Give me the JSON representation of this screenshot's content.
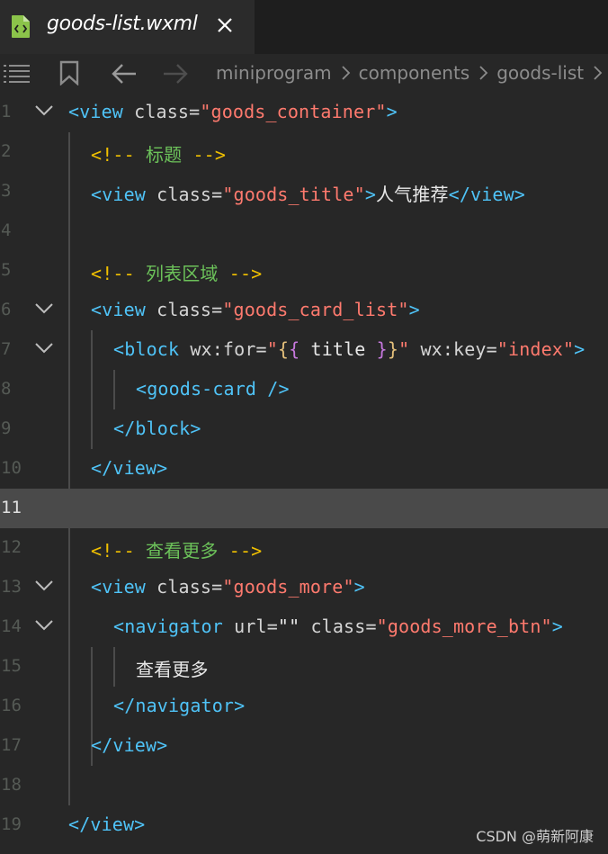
{
  "tab": {
    "title": "goods-list.wxml",
    "file_icon": "wxml-file-icon",
    "close_icon": "close-icon"
  },
  "toolbar": {
    "icons": [
      "outline-list-icon",
      "bookmark-icon",
      "back-arrow-icon",
      "forward-arrow-icon"
    ],
    "breadcrumb": [
      "miniprogram",
      "components",
      "goods-list"
    ]
  },
  "editor": {
    "current_line": 11,
    "lines": [
      {
        "num": "1"
      },
      {
        "num": "2"
      },
      {
        "num": "3"
      },
      {
        "num": "4"
      },
      {
        "num": "5"
      },
      {
        "num": "6"
      },
      {
        "num": "7"
      },
      {
        "num": "8"
      },
      {
        "num": "9"
      },
      {
        "num": "10"
      },
      {
        "num": "11"
      },
      {
        "num": "12"
      },
      {
        "num": "13"
      },
      {
        "num": "14"
      },
      {
        "num": "15"
      },
      {
        "num": "16"
      },
      {
        "num": "17"
      },
      {
        "num": "18"
      },
      {
        "num": "19"
      }
    ],
    "code": {
      "l1": {
        "open": "<",
        "tag": "view",
        "attr": " class=",
        "q1": "\"",
        "val": "goods_container",
        "q2": "\"",
        "close": ">"
      },
      "l2": {
        "c_open": "<!--",
        "c_text": " 标题 ",
        "c_close": "-->"
      },
      "l3": {
        "open": "<",
        "tag": "view",
        "attr": " class=",
        "q1": "\"",
        "val": "goods_title",
        "q2": "\"",
        "close": ">",
        "text": "人气推荐",
        "end": "</view>"
      },
      "l5": {
        "c_open": "<!--",
        "c_text": " 列表区域 ",
        "c_close": "-->"
      },
      "l6": {
        "open": "<",
        "tag": "view",
        "attr": " class=",
        "q1": "\"",
        "val": "goods_card_list",
        "q2": "\"",
        "close": ">"
      },
      "l7": {
        "open": "<",
        "tag": "block",
        "attr": " wx:for=",
        "q1": "\"",
        "b1": "{",
        "b2": "{",
        "expr": " title ",
        "b3": "}",
        "b4": "}",
        "q2": "\"",
        "attr2": " wx:key=",
        "q3": "\"",
        "val2": "index",
        "q4": "\"",
        "close": ">"
      },
      "l8": {
        "text": "<goods-card />"
      },
      "l9": {
        "text": "</block>"
      },
      "l10": {
        "text": "</view>"
      },
      "l12": {
        "c_open": "<!--",
        "c_text": " 查看更多 ",
        "c_close": "-->"
      },
      "l13": {
        "open": "<",
        "tag": "view",
        "attr": " class=",
        "q1": "\"",
        "val": "goods_more",
        "q2": "\"",
        "close": ">"
      },
      "l14": {
        "open": "<",
        "tag": "navigator",
        "attr": " url=",
        "qq": "\"\"",
        "attr2": " class=",
        "q1": "\"",
        "val": "goods_more_btn",
        "q2": "\"",
        "close": ">"
      },
      "l15": {
        "text": "查看更多"
      },
      "l16": {
        "text": "</navigator>"
      },
      "l17": {
        "text": "</view>"
      },
      "l19": {
        "text": "</view>"
      }
    }
  },
  "watermark": "CSDN @萌新阿康",
  "colors": {
    "background": "#272727",
    "tag": "#4fc3f7",
    "string": "#ff7a6e",
    "comment_delim": "#f0c000",
    "comment_text": "#6cc25a",
    "current_line": "#4a4a4a"
  }
}
